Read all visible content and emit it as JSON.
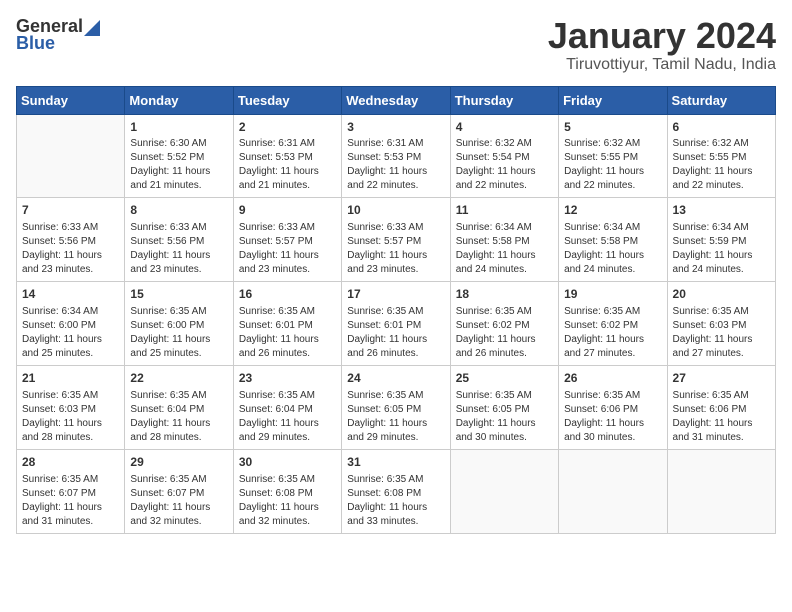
{
  "logo": {
    "general": "General",
    "blue": "Blue"
  },
  "title": "January 2024",
  "location": "Tiruvottiyur, Tamil Nadu, India",
  "weekdays": [
    "Sunday",
    "Monday",
    "Tuesday",
    "Wednesday",
    "Thursday",
    "Friday",
    "Saturday"
  ],
  "weeks": [
    [
      {
        "day": "",
        "info": ""
      },
      {
        "day": "1",
        "info": "Sunrise: 6:30 AM\nSunset: 5:52 PM\nDaylight: 11 hours\nand 21 minutes."
      },
      {
        "day": "2",
        "info": "Sunrise: 6:31 AM\nSunset: 5:53 PM\nDaylight: 11 hours\nand 21 minutes."
      },
      {
        "day": "3",
        "info": "Sunrise: 6:31 AM\nSunset: 5:53 PM\nDaylight: 11 hours\nand 22 minutes."
      },
      {
        "day": "4",
        "info": "Sunrise: 6:32 AM\nSunset: 5:54 PM\nDaylight: 11 hours\nand 22 minutes."
      },
      {
        "day": "5",
        "info": "Sunrise: 6:32 AM\nSunset: 5:55 PM\nDaylight: 11 hours\nand 22 minutes."
      },
      {
        "day": "6",
        "info": "Sunrise: 6:32 AM\nSunset: 5:55 PM\nDaylight: 11 hours\nand 22 minutes."
      }
    ],
    [
      {
        "day": "7",
        "info": "Sunrise: 6:33 AM\nSunset: 5:56 PM\nDaylight: 11 hours\nand 23 minutes."
      },
      {
        "day": "8",
        "info": "Sunrise: 6:33 AM\nSunset: 5:56 PM\nDaylight: 11 hours\nand 23 minutes."
      },
      {
        "day": "9",
        "info": "Sunrise: 6:33 AM\nSunset: 5:57 PM\nDaylight: 11 hours\nand 23 minutes."
      },
      {
        "day": "10",
        "info": "Sunrise: 6:33 AM\nSunset: 5:57 PM\nDaylight: 11 hours\nand 23 minutes."
      },
      {
        "day": "11",
        "info": "Sunrise: 6:34 AM\nSunset: 5:58 PM\nDaylight: 11 hours\nand 24 minutes."
      },
      {
        "day": "12",
        "info": "Sunrise: 6:34 AM\nSunset: 5:58 PM\nDaylight: 11 hours\nand 24 minutes."
      },
      {
        "day": "13",
        "info": "Sunrise: 6:34 AM\nSunset: 5:59 PM\nDaylight: 11 hours\nand 24 minutes."
      }
    ],
    [
      {
        "day": "14",
        "info": "Sunrise: 6:34 AM\nSunset: 6:00 PM\nDaylight: 11 hours\nand 25 minutes."
      },
      {
        "day": "15",
        "info": "Sunrise: 6:35 AM\nSunset: 6:00 PM\nDaylight: 11 hours\nand 25 minutes."
      },
      {
        "day": "16",
        "info": "Sunrise: 6:35 AM\nSunset: 6:01 PM\nDaylight: 11 hours\nand 26 minutes."
      },
      {
        "day": "17",
        "info": "Sunrise: 6:35 AM\nSunset: 6:01 PM\nDaylight: 11 hours\nand 26 minutes."
      },
      {
        "day": "18",
        "info": "Sunrise: 6:35 AM\nSunset: 6:02 PM\nDaylight: 11 hours\nand 26 minutes."
      },
      {
        "day": "19",
        "info": "Sunrise: 6:35 AM\nSunset: 6:02 PM\nDaylight: 11 hours\nand 27 minutes."
      },
      {
        "day": "20",
        "info": "Sunrise: 6:35 AM\nSunset: 6:03 PM\nDaylight: 11 hours\nand 27 minutes."
      }
    ],
    [
      {
        "day": "21",
        "info": "Sunrise: 6:35 AM\nSunset: 6:03 PM\nDaylight: 11 hours\nand 28 minutes."
      },
      {
        "day": "22",
        "info": "Sunrise: 6:35 AM\nSunset: 6:04 PM\nDaylight: 11 hours\nand 28 minutes."
      },
      {
        "day": "23",
        "info": "Sunrise: 6:35 AM\nSunset: 6:04 PM\nDaylight: 11 hours\nand 29 minutes."
      },
      {
        "day": "24",
        "info": "Sunrise: 6:35 AM\nSunset: 6:05 PM\nDaylight: 11 hours\nand 29 minutes."
      },
      {
        "day": "25",
        "info": "Sunrise: 6:35 AM\nSunset: 6:05 PM\nDaylight: 11 hours\nand 30 minutes."
      },
      {
        "day": "26",
        "info": "Sunrise: 6:35 AM\nSunset: 6:06 PM\nDaylight: 11 hours\nand 30 minutes."
      },
      {
        "day": "27",
        "info": "Sunrise: 6:35 AM\nSunset: 6:06 PM\nDaylight: 11 hours\nand 31 minutes."
      }
    ],
    [
      {
        "day": "28",
        "info": "Sunrise: 6:35 AM\nSunset: 6:07 PM\nDaylight: 11 hours\nand 31 minutes."
      },
      {
        "day": "29",
        "info": "Sunrise: 6:35 AM\nSunset: 6:07 PM\nDaylight: 11 hours\nand 32 minutes."
      },
      {
        "day": "30",
        "info": "Sunrise: 6:35 AM\nSunset: 6:08 PM\nDaylight: 11 hours\nand 32 minutes."
      },
      {
        "day": "31",
        "info": "Sunrise: 6:35 AM\nSunset: 6:08 PM\nDaylight: 11 hours\nand 33 minutes."
      },
      {
        "day": "",
        "info": ""
      },
      {
        "day": "",
        "info": ""
      },
      {
        "day": "",
        "info": ""
      }
    ]
  ]
}
